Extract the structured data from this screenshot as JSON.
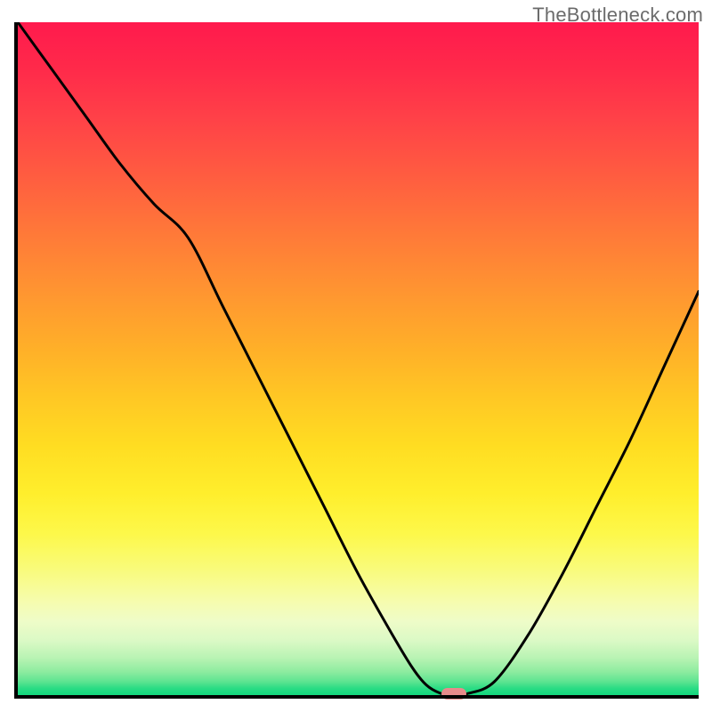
{
  "watermark": "TheBottleneck.com",
  "chart_data": {
    "type": "line",
    "title": "",
    "xlabel": "",
    "ylabel": "",
    "xlim": [
      0,
      100
    ],
    "ylim": [
      0,
      100
    ],
    "x": [
      0,
      5,
      10,
      15,
      20,
      25,
      30,
      35,
      40,
      45,
      50,
      55,
      58,
      60,
      62,
      64,
      66,
      70,
      75,
      80,
      85,
      90,
      95,
      100
    ],
    "values": [
      100,
      93,
      86,
      79,
      73,
      68,
      58,
      48,
      38,
      28,
      18,
      9,
      4,
      1.5,
      0.3,
      0,
      0.2,
      2,
      9,
      18,
      28,
      38,
      49,
      60
    ],
    "marker": {
      "x": 64,
      "y": 0
    },
    "background": "vertical-gradient-red-to-green"
  }
}
